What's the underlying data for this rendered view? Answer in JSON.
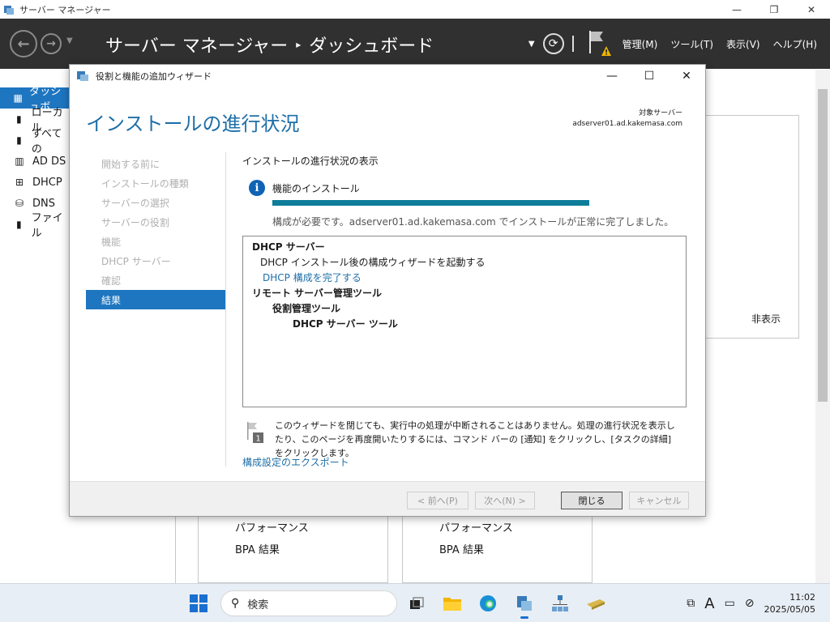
{
  "window": {
    "title": "サーバー マネージャー",
    "minimize": "—",
    "restore": "❐",
    "close": "✕"
  },
  "header": {
    "breadcrumb": [
      "サーバー マネージャー",
      "ダッシュボード"
    ],
    "menus": [
      "管理(M)",
      "ツール(T)",
      "表示(V)",
      "ヘルプ(H)"
    ]
  },
  "sidebar": {
    "items": [
      {
        "label": "ダッシュボ",
        "selected": true
      },
      {
        "label": "ローカル"
      },
      {
        "label": "すべての"
      },
      {
        "label": "AD DS"
      },
      {
        "label": "DHCP"
      },
      {
        "label": "DNS"
      },
      {
        "label": "ファイル"
      }
    ]
  },
  "background": {
    "hide_label": "非表示",
    "pane_left": {
      "line1": "パフォーマンス",
      "line2": "BPA 結果"
    },
    "pane_right": {
      "line1": "パフォーマンス",
      "line2": "BPA 結果"
    }
  },
  "wizard": {
    "title": "役割と機能の追加ウィザード",
    "heading": "インストールの進行状況",
    "target_label": "対象サーバー",
    "target_server": "adserver01.ad.kakemasa.com",
    "steps": [
      {
        "label": "開始する前に"
      },
      {
        "label": "インストールの種類"
      },
      {
        "label": "サーバーの選択"
      },
      {
        "label": "サーバーの役割"
      },
      {
        "label": "機能"
      },
      {
        "label": "DHCP サーバー"
      },
      {
        "label": "確認"
      },
      {
        "label": "結果",
        "current": true
      }
    ],
    "view_label": "インストールの進行状況の表示",
    "feature_install": "機能のインストール",
    "progress_percent": 100,
    "status_text": "構成が必要です。adserver01.ad.kakemasa.com でインストールが正常に完了しました。",
    "results": [
      {
        "text": "DHCP サーバー",
        "level": 0,
        "bold": true
      },
      {
        "text": "DHCP インストール後の構成ウィザードを起動する",
        "level": 1
      },
      {
        "text": "DHCP 構成を完了する",
        "level": 1,
        "link": true
      },
      {
        "text": "リモート サーバー管理ツール",
        "level": 0,
        "bold": true
      },
      {
        "text": "役割管理ツール",
        "level": 2,
        "bold": true
      },
      {
        "text": "DHCP サーバー ツール",
        "level": 3,
        "bold": true
      }
    ],
    "notice": "このウィザードを閉じても、実行中の処理が中断されることはありません。処理の進行状況を表示したり、このページを再度開いたりするには、コマンド バーの [通知] をクリックし、[タスクの詳細] をクリックします。",
    "notice_badge": "1",
    "export_link": "構成設定のエクスポート",
    "buttons": {
      "prev": "< 前へ(P)",
      "next": "次へ(N) >",
      "close": "閉じる",
      "cancel": "キャンセル"
    }
  },
  "taskbar": {
    "search_placeholder": "検索",
    "ime": "A",
    "time": "11:02",
    "date": "2025/05/05"
  },
  "colors": {
    "accent": "#1e76c0",
    "header_bg": "#303030",
    "progress": "#0e7d9a",
    "heading": "#1e6fa8"
  }
}
